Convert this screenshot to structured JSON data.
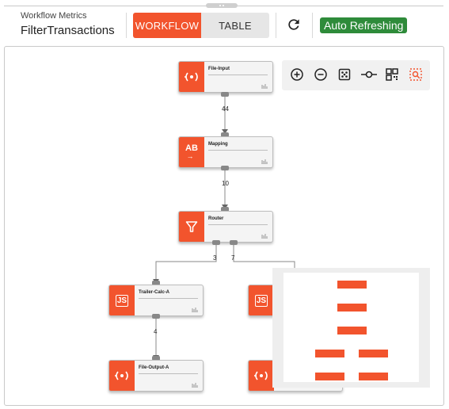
{
  "header": {
    "subtitle": "Workflow Metrics",
    "title": "FilterTransactions",
    "tabs": [
      {
        "label": "WORKFLOW",
        "active": true
      },
      {
        "label": "TABLE",
        "active": false
      }
    ],
    "refresh_icon": "refresh-icon",
    "status_badge": "Auto Refreshing"
  },
  "colors": {
    "accent": "#f2542d",
    "badge": "#2e8b3a",
    "canvas_border": "#c9c9c9"
  },
  "zoom_controls": [
    {
      "name": "zoom-in-icon"
    },
    {
      "name": "zoom-out-icon"
    },
    {
      "name": "fit-view-icon"
    },
    {
      "name": "line-connector-icon"
    },
    {
      "name": "layout-grid-icon"
    },
    {
      "name": "minimap-toggle-icon"
    }
  ],
  "nodes": {
    "file_input": {
      "label": "File-Input",
      "icon": "signal-icon"
    },
    "mapping": {
      "label": "Mapping",
      "icon": "ab-arrow-icon",
      "icon_text": "AB"
    },
    "router": {
      "label": "Router",
      "icon": "funnel-icon"
    },
    "trailer_calc_a": {
      "label": "Trailer-Calc-A",
      "icon": "js-icon",
      "icon_text": "JS"
    },
    "trailer_calc_b": {
      "icon": "js-icon",
      "icon_text": "JS"
    },
    "file_output_a": {
      "label": "File-Output-A",
      "icon": "signal-icon"
    },
    "file_output_b": {
      "icon": "signal-icon"
    }
  },
  "edges": {
    "input_to_mapping": "44",
    "mapping_to_router": "10",
    "router_to_a": "3",
    "router_to_b": "7",
    "a_to_output": "4"
  }
}
